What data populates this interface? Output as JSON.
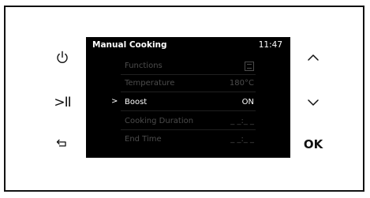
{
  "screen": {
    "title": "Manual Cooking",
    "time": "11:47",
    "menu": [
      {
        "label": "Functions",
        "value": "",
        "icon": "oven-function-icon",
        "active": false
      },
      {
        "label": "Temperature",
        "value": "180°C",
        "active": false
      },
      {
        "label": "Boost",
        "value": "ON",
        "indicator": ">",
        "active": true
      },
      {
        "label": "Cooking Duration",
        "value": "_ _:_ _",
        "active": false
      },
      {
        "label": "End Time",
        "value": "_ _:_ _",
        "active": false
      }
    ]
  },
  "buttons": {
    "power": "power-icon",
    "play_pause": ">II",
    "back": "back-arrow-icon",
    "up": "chevron-up-icon",
    "down": "chevron-down-icon",
    "ok": "OK"
  },
  "colors": {
    "screen_bg": "#000000",
    "active_text": "#ffffff",
    "inactive_text": "#4c4c4c"
  }
}
